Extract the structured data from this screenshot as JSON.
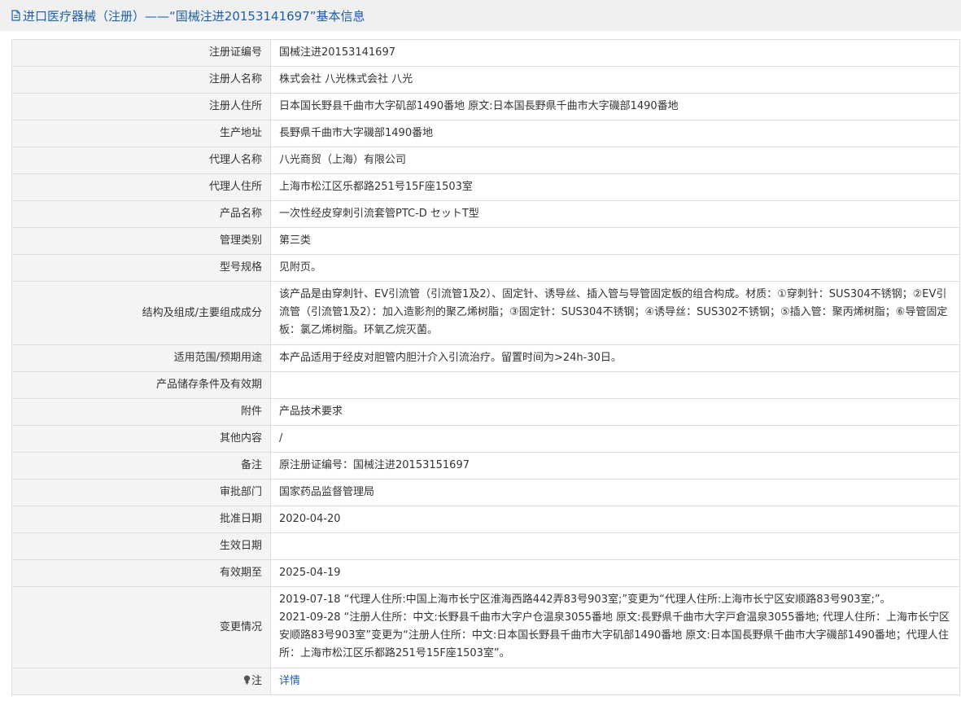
{
  "header": {
    "title": "进口医疗器械（注册）——“国械注进20153141697”基本信息",
    "icon": "document-icon"
  },
  "rows": [
    {
      "key": "reg_no",
      "label": "注册证编号",
      "value": "国械注进20153141697"
    },
    {
      "key": "registrant_name",
      "label": "注册人名称",
      "value": "株式会社 八光株式会社 八光"
    },
    {
      "key": "registrant_address",
      "label": "注册人住所",
      "value": "日本国长野县千曲市大字矶部1490番地 原文:日本国長野県千曲市大字磯部1490番地"
    },
    {
      "key": "production_address",
      "label": "生产地址",
      "value": "長野県千曲市大字磯部1490番地"
    },
    {
      "key": "agent_name",
      "label": "代理人名称",
      "value": "八光商贸（上海）有限公司"
    },
    {
      "key": "agent_address",
      "label": "代理人住所",
      "value": "上海市松江区乐都路251号15F座1503室"
    },
    {
      "key": "product_name",
      "label": "产品名称",
      "value": "一次性经皮穿刺引流套管PTC-D セットT型"
    },
    {
      "key": "category",
      "label": "管理类别",
      "value": "第三类"
    },
    {
      "key": "model_spec",
      "label": "型号规格",
      "value": "见附页。"
    },
    {
      "key": "structure",
      "label": "结构及组成/主要组成成分",
      "value": "该产品是由穿刺针、EV引流管（引流管1及2）、固定针、诱导丝、插入管与导管固定板的组合构成。材质：①穿刺针：SUS304不锈钢；②EV引流管（引流管1及2）：加入造影剂的聚乙烯树脂；③固定针：SUS304不锈钢；④诱导丝：SUS302不锈钢；⑤插入管：聚丙烯树脂；⑥导管固定板：氯乙烯树脂。环氧乙烷灭菌。"
    },
    {
      "key": "intended_use",
      "label": "适用范围/预期用途",
      "value": "本产品适用于经皮对胆管内胆汁介入引流治疗。留置时间为>24h-30日。"
    },
    {
      "key": "storage",
      "label": "产品储存条件及有效期",
      "value": ""
    },
    {
      "key": "attachment",
      "label": "附件",
      "value": "产品技术要求"
    },
    {
      "key": "other",
      "label": "其他内容",
      "value": "/"
    },
    {
      "key": "remark",
      "label": "备注",
      "value": "原注册证编号：国械注进20153151697"
    },
    {
      "key": "dept",
      "label": "审批部门",
      "value": "国家药品监督管理局"
    },
    {
      "key": "approval_date",
      "label": "批准日期",
      "value": "2020-04-20"
    },
    {
      "key": "effective_date",
      "label": "生效日期",
      "value": ""
    },
    {
      "key": "expiry_date",
      "label": "有效期至",
      "value": "2025-04-19"
    }
  ],
  "changes": {
    "label": "变更情况",
    "lines": [
      "2019-07-18 “代理人住所:中国上海市长宁区淮海西路442弄83号903室;”变更为“代理人住所:上海市长宁区安顺路83号903室;”。",
      "2021-09-28 “注册人住所：中文:长野县千曲市大字户仓温泉3055番地 原文:長野県千曲市大字戸倉温泉3055番地; 代理人住所：上海市长宁区安顺路83号903室”变更为“注册人住所：中文:日本国长野县千曲市大字矶部1490番地 原文:日本国長野県千曲市大字磯部1490番地；代理人住所：上海市松江区乐都路251号15F座1503室”。"
    ]
  },
  "note": {
    "label": "注",
    "icon": "lightbulb-icon",
    "link_text": "详情"
  },
  "colors": {
    "title_text": "#1d5fa8",
    "label_bg": "#f4f4f4",
    "border": "#dddddd"
  }
}
